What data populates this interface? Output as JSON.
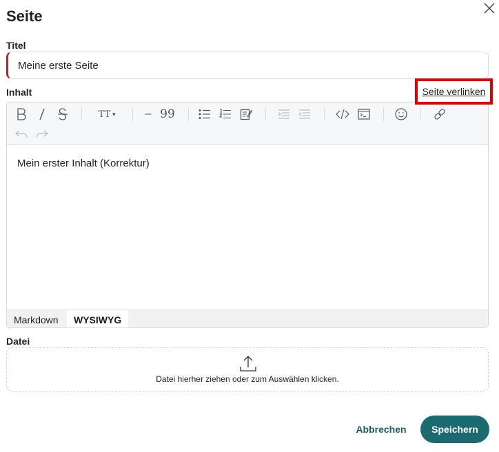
{
  "dialog": {
    "title": "Seite"
  },
  "form": {
    "title_label": "Titel",
    "title_value": "Meine erste Seite",
    "content_label": "Inhalt",
    "link_page": "Seite verlinken",
    "file_label": "Datei"
  },
  "editor": {
    "content_text": "Mein erster Inhalt (Korrektur)",
    "toolbar": {
      "heading_glyph": "TT",
      "hr_glyph": "–",
      "quote_glyph": "99"
    },
    "modes": {
      "markdown": "Markdown",
      "wysiwyg": "WYSIWYG",
      "active": "WYSIWYG"
    }
  },
  "dropzone": {
    "hint": "Datei hierher ziehen oder zum Auswählen klicken."
  },
  "actions": {
    "cancel": "Abbrechen",
    "save": "Speichern"
  },
  "colors": {
    "accent": "#1b6a70",
    "error_border": "#b3262d",
    "highlight": "#e00000"
  }
}
